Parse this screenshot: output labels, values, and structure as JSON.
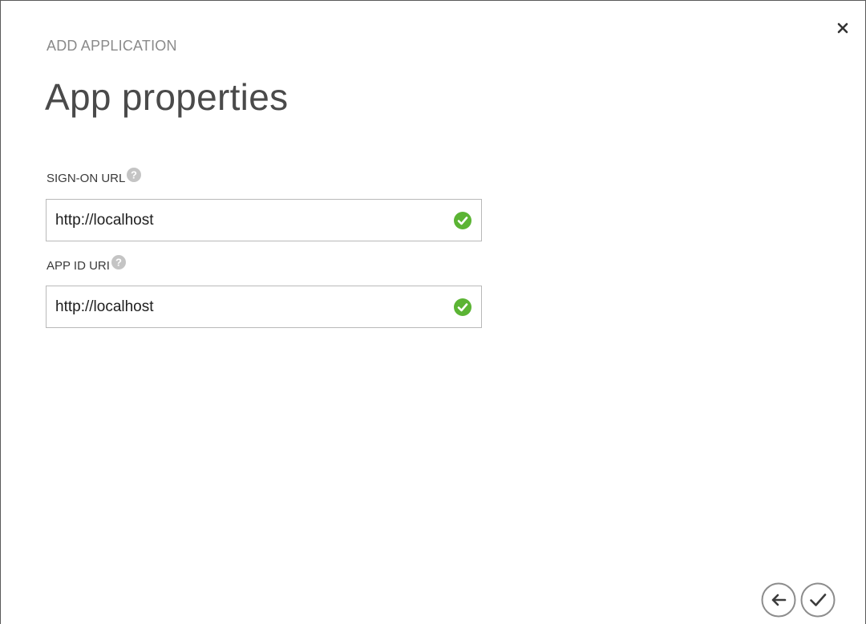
{
  "dialog": {
    "eyebrow": "ADD APPLICATION",
    "title": "App properties",
    "close_label": "×"
  },
  "fields": [
    {
      "label": "SIGN-ON URL",
      "value": "http://localhost",
      "valid": true
    },
    {
      "label": "APP ID URI",
      "value": "http://localhost",
      "valid": true
    }
  ],
  "icons": {
    "help": "help-icon",
    "valid": "check-circle-icon",
    "back": "arrow-left-icon",
    "confirm": "checkmark-icon",
    "close": "close-icon"
  },
  "colors": {
    "valid_green": "#5bb434",
    "help_gray": "#c4c4c4",
    "nav_gray": "#8c8c8c"
  }
}
